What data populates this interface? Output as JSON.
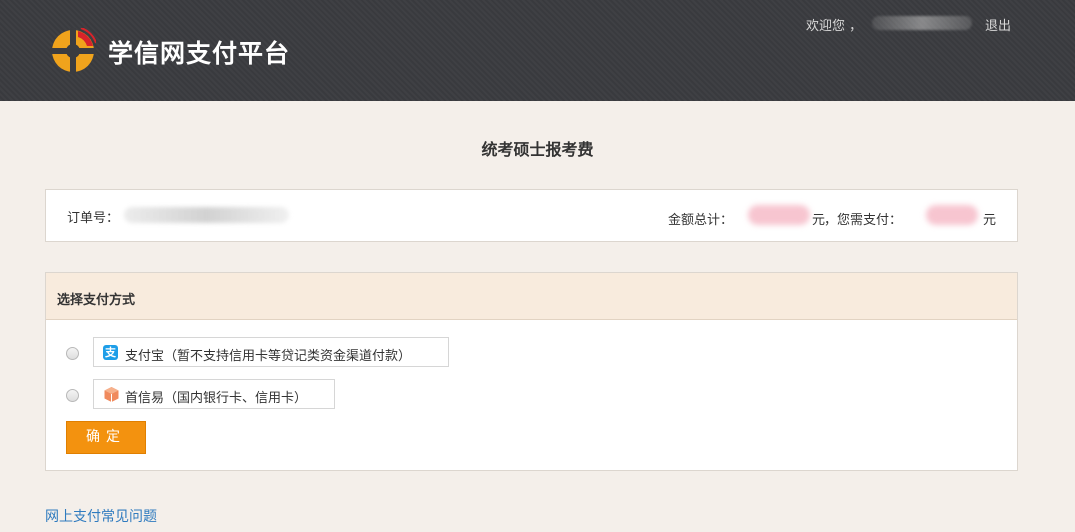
{
  "header": {
    "brand": "学信网支付平台",
    "welcome": "欢迎您 ，",
    "logout": "退出"
  },
  "page_title": "统考硕士报考费",
  "order": {
    "order_label": "订单号：",
    "amount_label": "金额总计：",
    "yuan": "元",
    "need_label": "，您需支付：",
    "yuan2": "元"
  },
  "payment": {
    "title": "选择支付方式",
    "options": [
      {
        "label": "支付宝（暂不支持信用卡等贷记类资金渠道付款）",
        "icon": "alipay-icon"
      },
      {
        "label": "首信易（国内银行卡、信用卡）",
        "icon": "shouxinyi-icon"
      }
    ],
    "confirm": "确定"
  },
  "faq_link": "网上支付常见问题",
  "colors": {
    "header_bg": "#3b3c40",
    "accent_orange": "#f3920f",
    "link_blue": "#2f7bbf",
    "alipay_blue": "#1e9ee8"
  }
}
